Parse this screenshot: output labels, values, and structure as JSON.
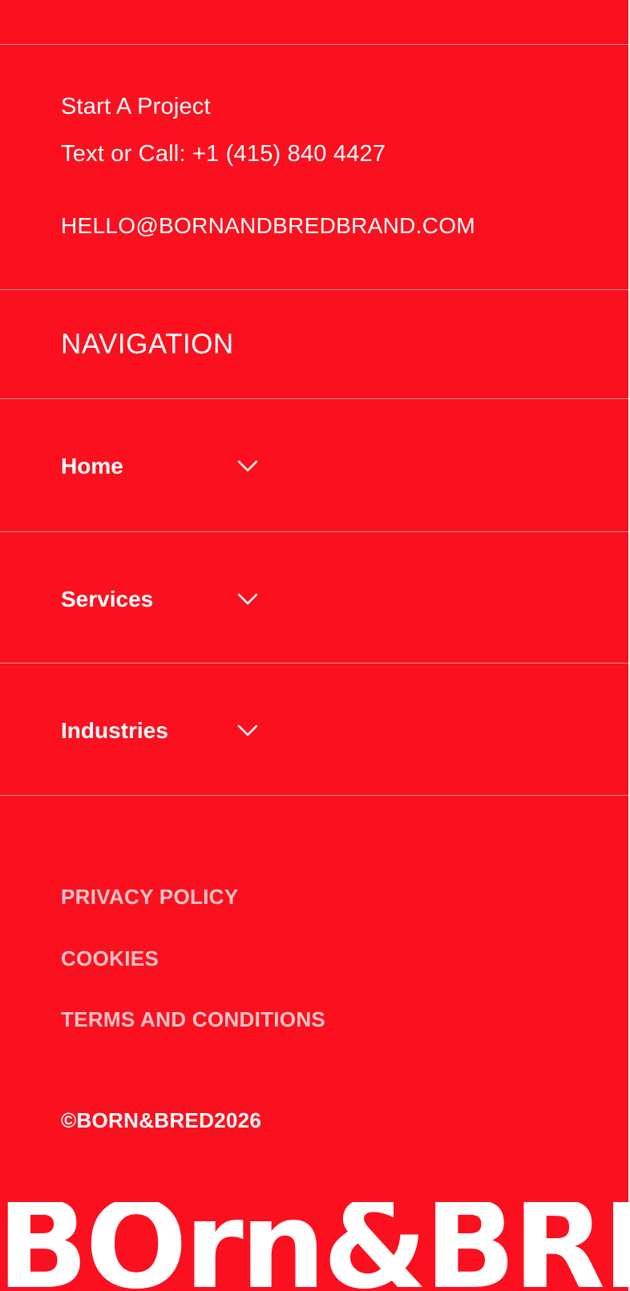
{
  "colors": {
    "background": "#FB101F",
    "text": "#FFFFFF",
    "legal_text": "#FFC3C7"
  },
  "contact": {
    "start_project": "Start A Project",
    "phone": "Text or Call: +1 (415) 840 4427",
    "email": "HELLO@BORNANDBREDBRAND.COM"
  },
  "navigation": {
    "heading": "NAVIGATION",
    "items": [
      {
        "label": "Home",
        "icon": "chevron-down-icon"
      },
      {
        "label": "Services",
        "icon": "chevron-down-icon"
      },
      {
        "label": "Industries",
        "icon": "chevron-down-icon"
      }
    ]
  },
  "legal": {
    "links": [
      "PRIVACY POLICY",
      "COOKIES",
      "TERMS AND CONDITIONS"
    ]
  },
  "footer": {
    "copyright": "©BORN&BRED2026",
    "logo_text": "BOrn&BRED"
  }
}
